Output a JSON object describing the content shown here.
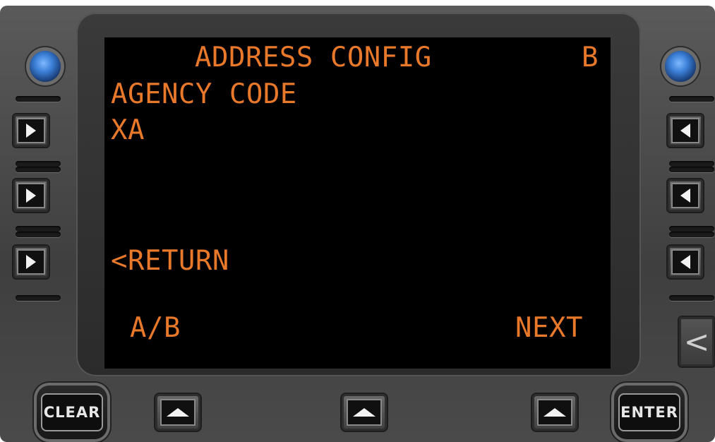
{
  "screen": {
    "title": "ADDRESS CONFIG",
    "side_indicator": "B",
    "line1": "AGENCY CODE",
    "line2": "XA",
    "return_label": "<RETURN",
    "left_soft_label": "A/B",
    "right_soft_label": "NEXT",
    "text_color": "#e8782a"
  },
  "buttons": {
    "clear_label": "CLEAR",
    "enter_label": "ENTER",
    "back_glyph": "<"
  },
  "icons": {
    "knob": "blue-knob-icon",
    "left_arrow": "triangle-right-icon",
    "right_arrow": "triangle-left-icon",
    "up_arrow": "triangle-up-icon"
  }
}
